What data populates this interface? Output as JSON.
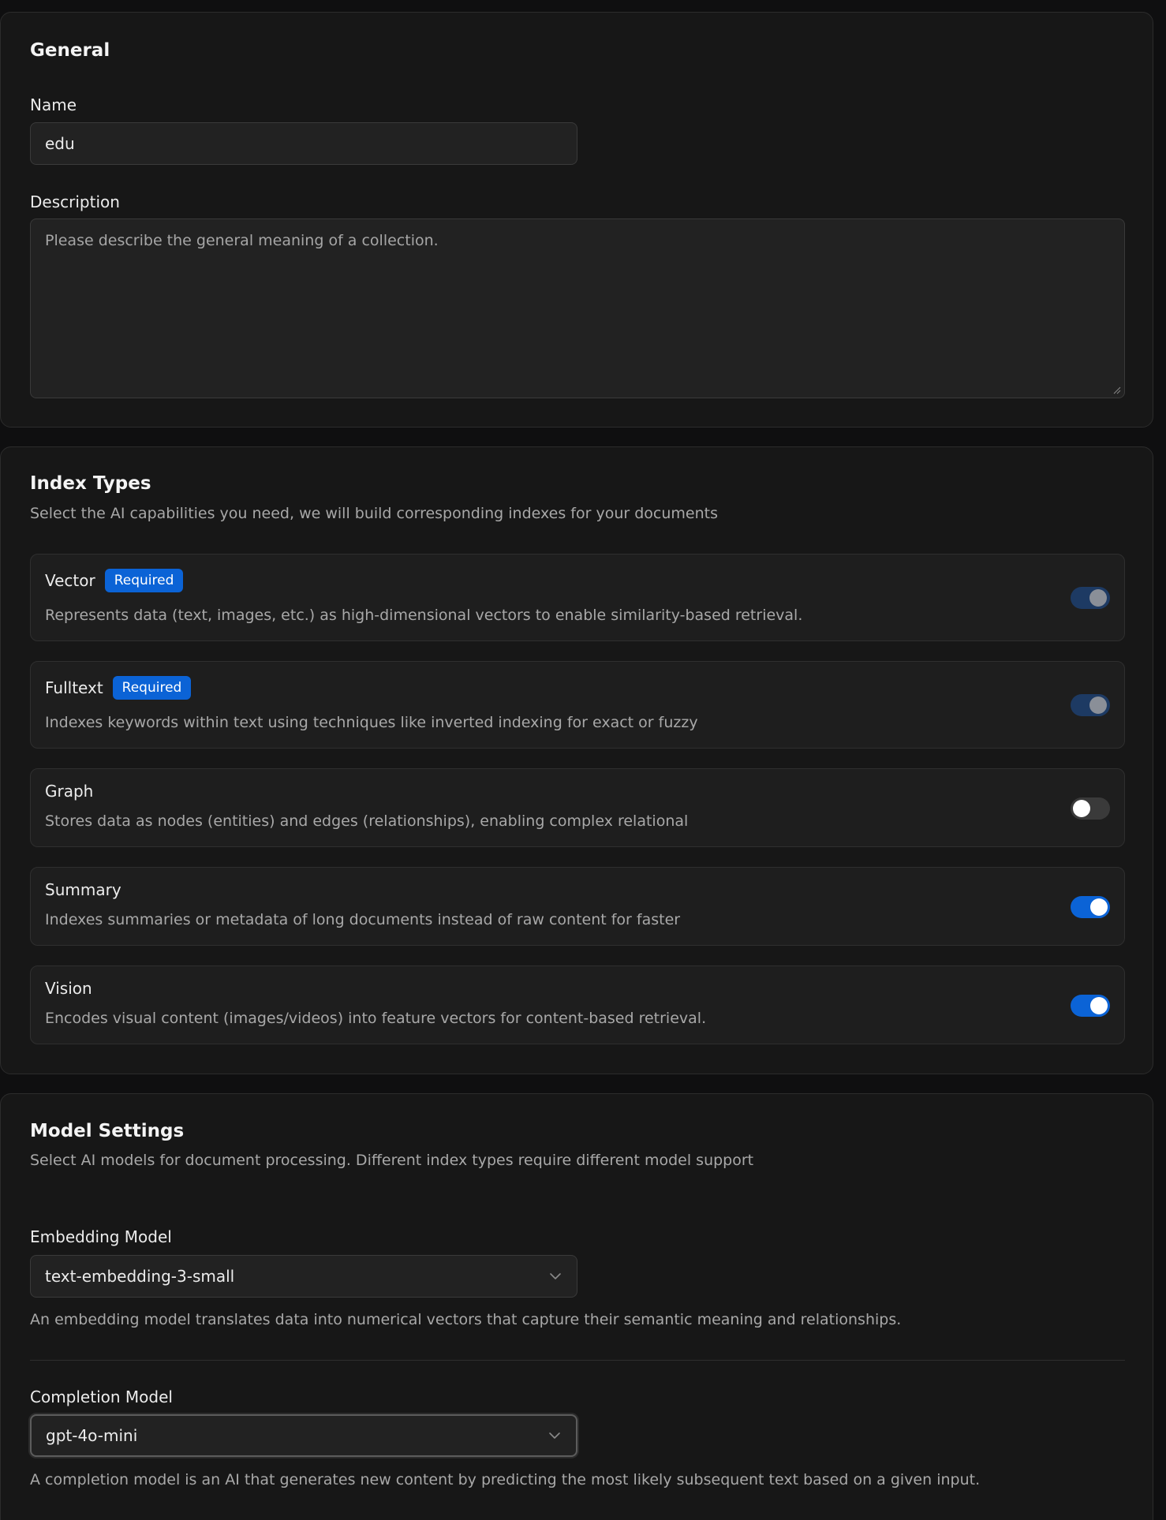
{
  "general": {
    "title": "General",
    "name_label": "Name",
    "name_value": "edu",
    "description_label": "Description",
    "description_placeholder": "Please describe the general meaning of a collection."
  },
  "index_types": {
    "title": "Index Types",
    "subtitle": "Select the AI capabilities you need, we will build corresponding indexes for your documents",
    "items": [
      {
        "name": "Vector",
        "badge": "Required",
        "description": "Represents data (text, images, etc.) as high-dimensional vectors to enable similarity-based retrieval.",
        "enabled": true,
        "locked": true
      },
      {
        "name": "Fulltext",
        "badge": "Required",
        "description": "Indexes keywords within text using techniques like inverted indexing for exact or fuzzy",
        "enabled": true,
        "locked": true
      },
      {
        "name": "Graph",
        "description": "Stores data as nodes (entities) and edges (relationships), enabling complex relational",
        "enabled": false,
        "locked": false
      },
      {
        "name": "Summary",
        "description": "Indexes summaries or metadata of long documents instead of raw content for faster",
        "enabled": true,
        "locked": false
      },
      {
        "name": "Vision",
        "description": "Encodes visual content (images/videos) into feature vectors for content-based retrieval.",
        "enabled": true,
        "locked": false
      }
    ]
  },
  "model_settings": {
    "title": "Model Settings",
    "subtitle": "Select AI models for document processing. Different index types require different model support",
    "embedding_label": "Embedding Model",
    "embedding_value": "text-embedding-3-small",
    "embedding_help": "An embedding model translates data into numerical vectors that capture their semantic meaning and relationships.",
    "completion_label": "Completion Model",
    "completion_value": "gpt-4o-mini",
    "completion_help": "A completion model is an AI that generates new content by predicting the most likely subsequent text based on a given input."
  },
  "colors": {
    "accent": "#0b63d6",
    "card_bg": "#171717",
    "page_bg": "#0f0f10"
  }
}
